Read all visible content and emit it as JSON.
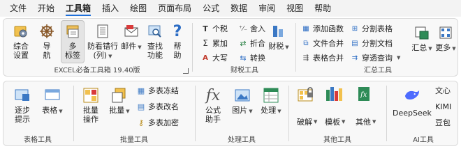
{
  "menu": [
    "文件",
    "开始",
    "工具箱",
    "插入",
    "绘图",
    "页面布局",
    "公式",
    "数据",
    "审阅",
    "视图",
    "帮助"
  ],
  "active_menu": "工具箱",
  "ribbon1": {
    "excel_group": {
      "label": "EXCEL必备工具箱 19.40版",
      "buttons": [
        {
          "l1": "综合",
          "l2": "设置",
          "icon": "settings-icon"
        },
        {
          "l1": "导",
          "l2": "航",
          "icon": "helm-icon"
        },
        {
          "l1": "多",
          "l2": "标签",
          "icon": "multi-tab-icon"
        },
        {
          "l1": "防看错行",
          "l2": "(列)",
          "icon": "row-highlight-icon"
        },
        {
          "l1": "邮件",
          "l2": "",
          "icon": "mail-icon"
        },
        {
          "l1": "查找",
          "l2": "功能",
          "icon": "find-icon"
        },
        {
          "l1": "帮",
          "l2": "助",
          "icon": "help-icon"
        }
      ]
    },
    "tax_group": {
      "label": "财税工具",
      "items": [
        "个税",
        "舍入",
        "累加",
        "折合",
        "大写",
        "转换",
        "财税"
      ]
    },
    "summary_group": {
      "label": "汇总工具",
      "items": [
        "添加函数",
        "分割表格",
        "文件合并",
        "分割文档",
        "表格合并",
        "穿透查询"
      ],
      "big": [
        "汇总",
        "更多"
      ]
    }
  },
  "ribbon2": {
    "table_group": {
      "label": "表格工具",
      "buttons": [
        {
          "l1": "逐步",
          "l2": "提示"
        },
        {
          "l1": "表格",
          "l2": ""
        }
      ]
    },
    "batch_group": {
      "label": "批量工具",
      "buttons": [
        {
          "l1": "批量",
          "l2": "操作"
        },
        {
          "l1": "批量",
          "l2": ""
        }
      ],
      "items": [
        "多表冻结",
        "多表改名",
        "多表加密"
      ]
    },
    "process_group": {
      "label": "处理工具",
      "buttons": [
        {
          "l1": "公式",
          "l2": "助手"
        },
        {
          "l1": "图片",
          "l2": ""
        },
        {
          "l1": "处理",
          "l2": ""
        }
      ]
    },
    "other_group": {
      "label": "其他工具",
      "items": [
        "破解",
        "模板",
        "其他"
      ]
    },
    "ai_group": {
      "label": "AI工具",
      "deepseek": "DeepSeek",
      "items": [
        "文心",
        "KIMI",
        "豆包"
      ]
    }
  },
  "colors": {
    "accent": "#1e6fd9",
    "band_bg": "#f8f8f8"
  }
}
